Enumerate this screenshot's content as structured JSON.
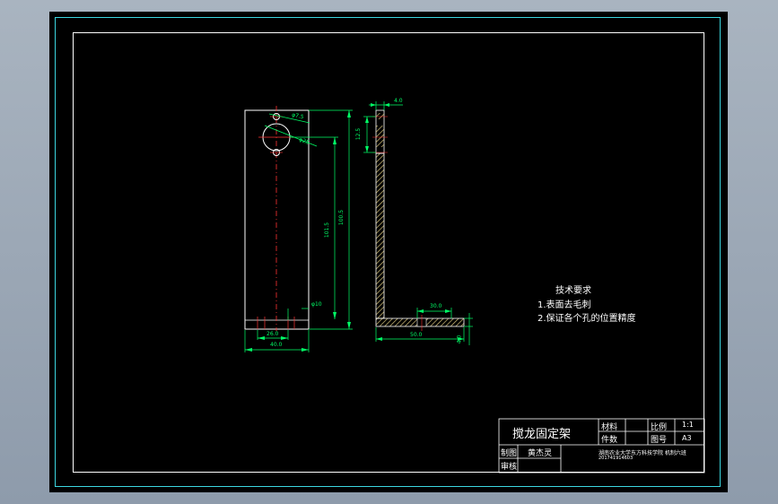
{
  "colors": {
    "background": "#000000",
    "border_cyan": "#3cd7e0",
    "outline": "#ffffff",
    "dimension": "#00ff66",
    "centerline": "#ff3333",
    "hatch": "#d6c27a",
    "note_text": "#ffffff"
  },
  "front_view": {
    "dim_hole1": "φ7.5",
    "dim_hole2": "φ25",
    "dim_height_total": "100.5",
    "dim_height_partial": "101.5",
    "dim_small": "φ10",
    "dim_slot": "26.0",
    "dim_width": "40.0"
  },
  "side_view": {
    "dim_thickness": "4.0",
    "dim_top": "12.5",
    "dim_flange_top": "30.0",
    "dim_flange_length": "50.0",
    "dim_flange_thickness": "4.0"
  },
  "tech_requirements": {
    "title": "技术要求",
    "items": [
      "1.表面去毛刺",
      "2.保证各个孔的位置精度"
    ]
  },
  "title_block": {
    "part_name": "搅龙固定架",
    "material_label": "材料",
    "quantity_label": "件数",
    "scale_label": "比例",
    "scale_value": "1:1",
    "drawing_no_label": "图号",
    "drawing_no_value": "A3",
    "drawn_label": "制图",
    "drawn_by": "黄杰灵",
    "checked_label": "审核",
    "org_line1": "湖南农业大学东方科技学院 机制六班",
    "org_line2": "201741914603"
  }
}
